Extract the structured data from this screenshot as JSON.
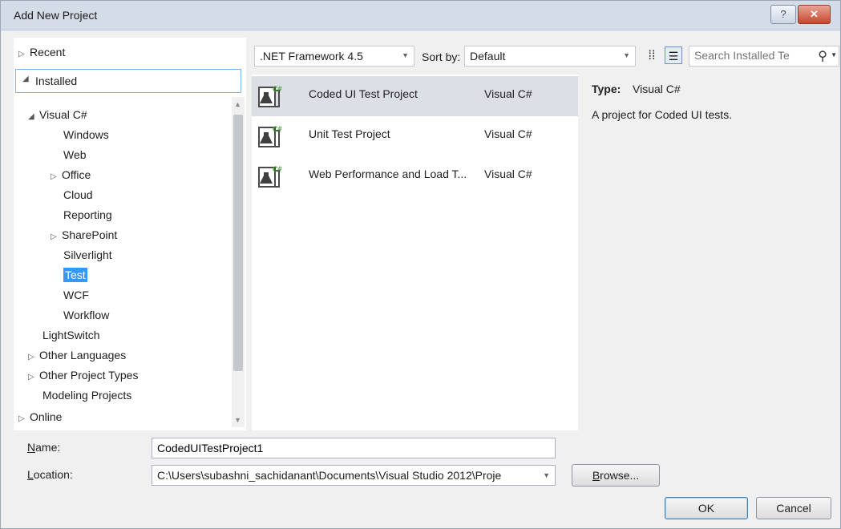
{
  "window": {
    "title": "Add New Project",
    "help_label": "?",
    "close_label": "✕"
  },
  "left_panel": {
    "recent": "Recent",
    "installed": "Installed",
    "online": "Online",
    "tree": [
      {
        "label": "Visual C#",
        "arrow": "◢",
        "level": 1
      },
      {
        "label": "Windows",
        "arrow": "",
        "level": 3
      },
      {
        "label": "Web",
        "arrow": "",
        "level": 3
      },
      {
        "label": "Office",
        "arrow": "▷",
        "level": 2
      },
      {
        "label": "Cloud",
        "arrow": "",
        "level": 3
      },
      {
        "label": "Reporting",
        "arrow": "",
        "level": 3
      },
      {
        "label": "SharePoint",
        "arrow": "▷",
        "level": 2
      },
      {
        "label": "Silverlight",
        "arrow": "",
        "level": 3
      },
      {
        "label": "Test",
        "arrow": "",
        "level": 3,
        "selected": true
      },
      {
        "label": "WCF",
        "arrow": "",
        "level": 3
      },
      {
        "label": "Workflow",
        "arrow": "",
        "level": 3
      },
      {
        "label": "LightSwitch",
        "arrow": "",
        "level": 1.5
      },
      {
        "label": "Other Languages",
        "arrow": "▷",
        "level": 1
      },
      {
        "label": "Other Project Types",
        "arrow": "▷",
        "level": 1
      },
      {
        "label": "Modeling Projects",
        "arrow": "",
        "level": 1.5
      }
    ]
  },
  "toolbar": {
    "framework": ".NET Framework 4.5",
    "sort_label": "Sort by:",
    "sort_value": "Default",
    "search_placeholder": "Search Installed Te"
  },
  "templates": [
    {
      "name": "Coded UI Test Project",
      "lang": "Visual C#",
      "selected": true
    },
    {
      "name": "Unit Test Project",
      "lang": "Visual C#",
      "selected": false
    },
    {
      "name": "Web Performance and Load T...",
      "lang": "Visual C#",
      "selected": false
    }
  ],
  "details": {
    "type_label": "Type:",
    "type_value": "Visual C#",
    "description": "A project for Coded UI tests."
  },
  "form": {
    "name_label_key": "N",
    "name_label_rest": "ame:",
    "name_value": "CodedUITestProject1",
    "location_label_key": "L",
    "location_label_rest": "ocation:",
    "location_value": "C:\\Users\\subashni_sachidanant\\Documents\\Visual Studio 2012\\Proje",
    "browse_key": "B",
    "browse_rest": "rowse...",
    "ok": "OK",
    "cancel": "Cancel"
  },
  "colors": {
    "selection": "#3399ff",
    "row_highlight": "#dcdfe6",
    "title_bar": "#d4dce8"
  }
}
